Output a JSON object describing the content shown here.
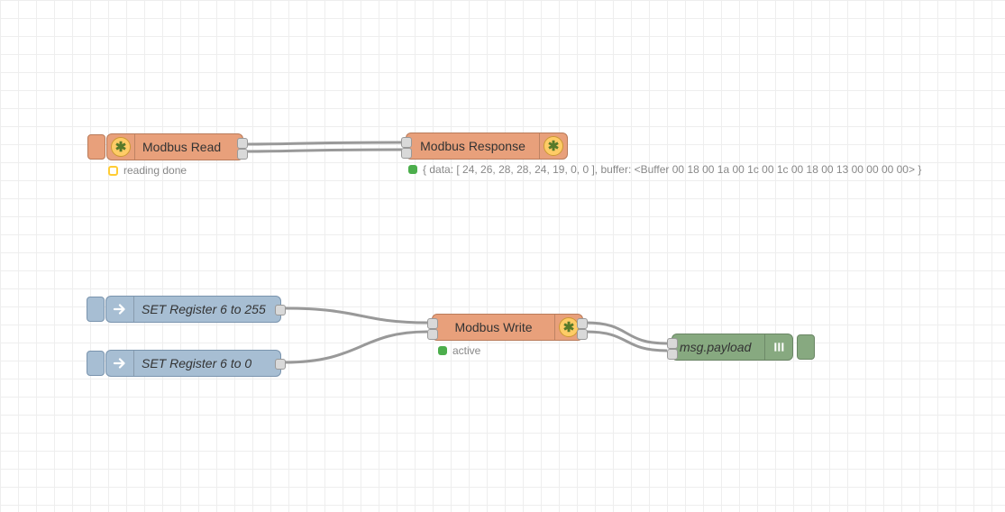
{
  "nodes": {
    "modbusRead": {
      "label": "Modbus Read",
      "status": "reading done",
      "statusColor": "#ffcc33",
      "type": "modbus-read"
    },
    "modbusResponse": {
      "label": "Modbus Response",
      "status": "{ data: [ 24, 26, 28, 28, 24, 19, 0, 0 ], buffer: <Buffer 00 18 00 1a 00 1c 00 1c 00 18 00 13 00 00 00 00> }",
      "statusColor": "#4cae4c",
      "type": "modbus-response",
      "payload": {
        "data": [
          24,
          26,
          28,
          28,
          24,
          19,
          0,
          0
        ],
        "bufferHex": "00 18 00 1a 00 1c 00 1c 00 18 00 13 00 00 00 00"
      }
    },
    "setReg255": {
      "label": "SET Register 6 to 255",
      "type": "inject",
      "register": 6,
      "value": 255
    },
    "setReg0": {
      "label": "SET Register 6 to 0",
      "type": "inject",
      "register": 6,
      "value": 0
    },
    "modbusWrite": {
      "label": "Modbus Write",
      "status": "active",
      "statusColor": "#4cae4c",
      "type": "modbus-write"
    },
    "debug": {
      "label": "msg.payload",
      "type": "debug"
    }
  },
  "wires": [
    {
      "from": "modbusRead",
      "to": "modbusResponse"
    },
    {
      "from": "setReg255",
      "to": "modbusWrite"
    },
    {
      "from": "setReg0",
      "to": "modbusWrite"
    },
    {
      "from": "modbusWrite",
      "to": "debug"
    }
  ],
  "colors": {
    "nodeOrange": "#e8a07b",
    "nodeBlue": "#a7bed3",
    "nodeGreen": "#87a980",
    "gridLine": "#eeeeee",
    "wire": "#999999"
  }
}
